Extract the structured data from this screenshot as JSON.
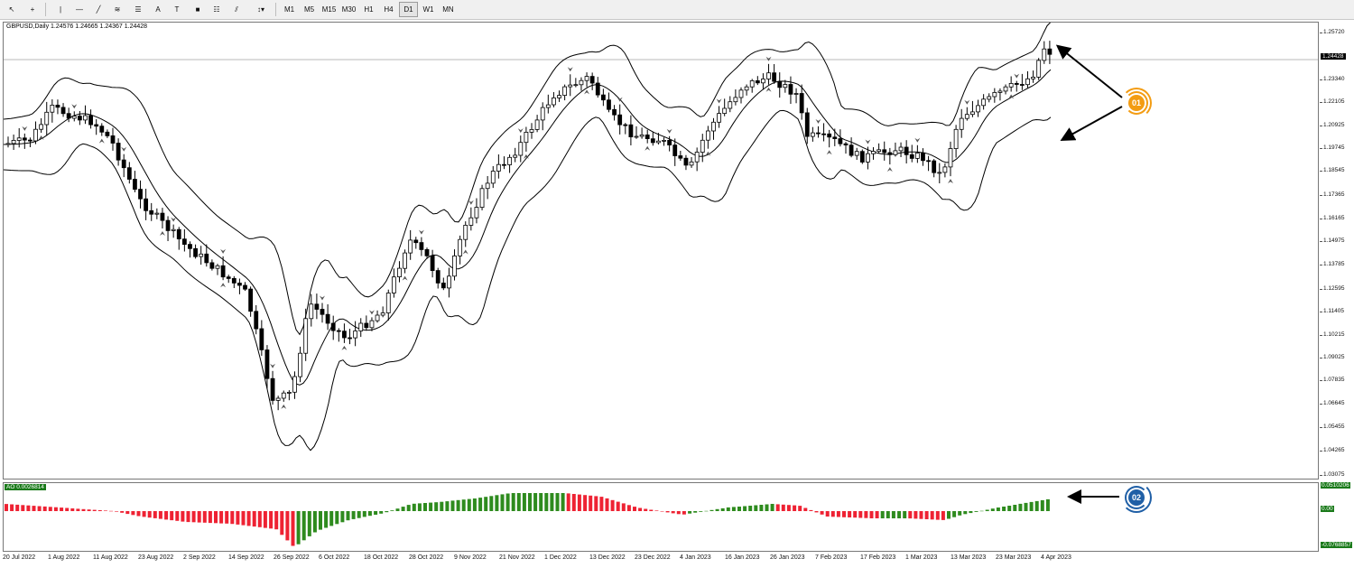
{
  "toolbar": {
    "tools": [
      {
        "name": "cursor-icon",
        "glyph": "↖"
      },
      {
        "name": "crosshair-icon",
        "glyph": "+"
      },
      {
        "name": "vertical-line-icon",
        "glyph": "|"
      },
      {
        "name": "horizontal-line-icon",
        "glyph": "—"
      },
      {
        "name": "trendline-icon",
        "glyph": "╱"
      },
      {
        "name": "fibonacci-channel-icon",
        "glyph": "≋"
      },
      {
        "name": "fibonacci-retracement-icon",
        "glyph": "☰"
      },
      {
        "name": "text-icon",
        "glyph": "A"
      },
      {
        "name": "text-label-icon",
        "glyph": "T"
      },
      {
        "name": "rectangle-icon",
        "glyph": "■"
      },
      {
        "name": "fibonacci-fan-icon",
        "glyph": "☷"
      },
      {
        "name": "equidistant-channel-icon",
        "glyph": "⫽"
      },
      {
        "name": "arrows-dropdown-icon",
        "glyph": "↕▾"
      }
    ],
    "timeframes": [
      "M1",
      "M5",
      "M15",
      "M30",
      "H1",
      "H4",
      "D1",
      "W1",
      "MN"
    ],
    "active_timeframe": "D1"
  },
  "chart": {
    "symbol_label": "GBPUSD,Daily  1.24576 1.24665 1.24367 1.24428",
    "current_price": "1.24428",
    "price_ticks": [
      "1.25720",
      "1.24428",
      "1.23340",
      "1.22105",
      "1.20925",
      "1.19745",
      "1.18545",
      "1.17365",
      "1.16165",
      "1.14975",
      "1.13785",
      "1.12595",
      "1.11405",
      "1.10215",
      "1.09025",
      "1.07835",
      "1.06645",
      "1.05455",
      "1.04265",
      "1.03075"
    ],
    "date_ticks": [
      "20 Jul 2022",
      "1 Aug 2022",
      "11 Aug 2022",
      "23 Aug 2022",
      "2 Sep 2022",
      "14 Sep 2022",
      "26 Sep 2022",
      "6 Oct 2022",
      "18 Oct 2022",
      "28 Oct 2022",
      "9 Nov 2022",
      "21 Nov 2022",
      "1 Dec 2022",
      "13 Dec 2022",
      "23 Dec 2022",
      "4 Jan 2023",
      "16 Jan 2023",
      "26 Jan 2023",
      "7 Feb 2023",
      "17 Feb 2023",
      "1 Mar 2023",
      "13 Mar 2023",
      "23 Mar 2023",
      "4 Apr 2023"
    ]
  },
  "indicator": {
    "label": "AO 0.0026814",
    "axis_values": [
      "0.0510206",
      "0.00",
      "-0.0768857"
    ]
  },
  "callouts": [
    {
      "number": "01",
      "color": "#f39c12"
    },
    {
      "number": "02",
      "color": "#1f5fa6"
    }
  ],
  "colors": {
    "bullish_bar": "#2e8b1e",
    "bearish_bar": "#ee2233",
    "candle": "#000000",
    "bands": "#000000"
  }
}
